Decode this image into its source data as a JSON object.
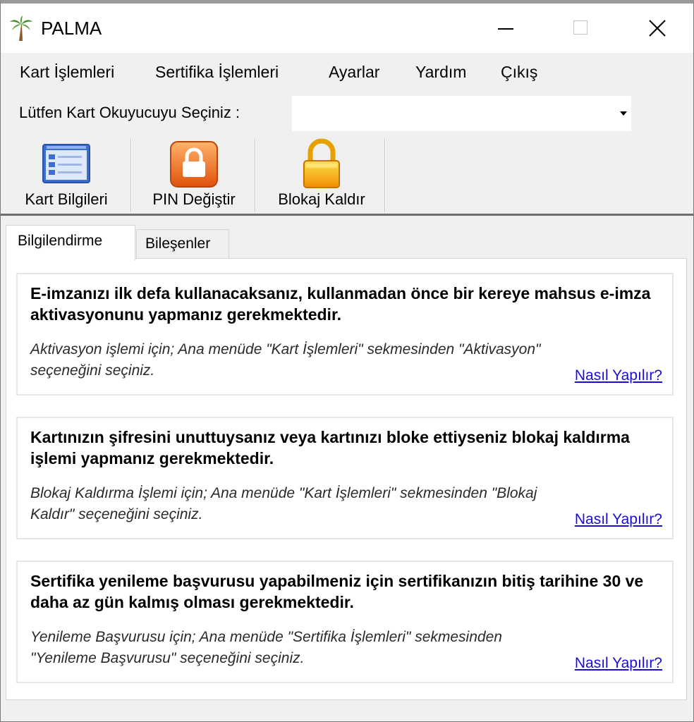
{
  "window": {
    "title": "PALMA",
    "app_icon": "palm-tree-icon"
  },
  "menu": {
    "items": [
      "Kart İşlemleri",
      "Sertifika İşlemleri",
      "Ayarlar",
      "Yardım",
      "Çıkış"
    ]
  },
  "reader": {
    "label": "Lütfen Kart Okuyucuyu Seçiniz :",
    "selected_value": ""
  },
  "toolbar": {
    "buttons": [
      {
        "label": "Kart Bilgileri",
        "icon": "card-info-icon"
      },
      {
        "label": "PIN Değiştir",
        "icon": "pin-lock-icon"
      },
      {
        "label": "Blokaj Kaldır",
        "icon": "padlock-icon"
      }
    ]
  },
  "tabs": [
    {
      "label": "Bilgilendirme",
      "active": true
    },
    {
      "label": "Bileşenler",
      "active": false
    }
  ],
  "cards": [
    {
      "heading": "E-imzanızı ilk defa kullanacaksanız, kullanmadan önce bir kereye mahsus e-imza aktivasyonunu yapmanız gerekmektedir.",
      "description": "Aktivasyon işlemi için; Ana menüde \"Kart İşlemleri\" sekmesinden \"Aktivasyon\" seçeneğini seçiniz.",
      "link": "Nasıl Yapılır?"
    },
    {
      "heading": "Kartınızın şifresini unuttuysanız veya kartınızı bloke ettiyseniz blokaj kaldırma işlemi yapmanız gerekmektedir.",
      "description": "Blokaj Kaldırma İşlemi için; Ana menüde \"Kart İşlemleri\" sekmesinden \"Blokaj Kaldır\" seçeneğini seçiniz.",
      "link": "Nasıl Yapılır?"
    },
    {
      "heading": "Sertifika yenileme başvurusu yapabilmeniz için sertifikanızın bitiş tarihine 30 ve daha az gün kalmış olması gerekmektedir.",
      "description": "Yenileme Başvurusu için; Ana menüde \"Sertifika İşlemleri\" sekmesinden \"Yenileme Başvurusu\" seçeneğini seçiniz.",
      "link": "Nasıl Yapılır?"
    }
  ],
  "colors": {
    "link": "#1a0dd8",
    "window_bg": "#f0f0f0"
  }
}
